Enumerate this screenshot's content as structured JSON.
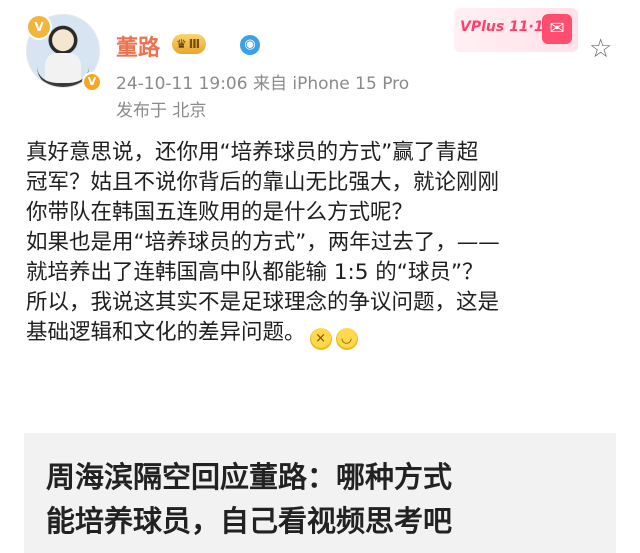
{
  "post": {
    "author": {
      "name": "董路",
      "level": "Ⅲ",
      "avatar_badge": "V",
      "verified_badge": "V"
    },
    "timestamp": "24-10-11 19:06",
    "source": "来自 iPhone 15 Pro",
    "location": "发布于 北京",
    "promo": {
      "label": "VPlus 11·11"
    },
    "body_lines": [
      "真好意思说，还你用“培养球员的方式”赢了青超",
      "冠军？姑且不说你背后的靠山无比强大，就论刚刚",
      "你带队在韩国五连败用的是什么方式呢？",
      "如果也是用“培养球员的方式”，两年过去了，——",
      "就培养出了连韩国高中队都能输 1:5 的“球员”？",
      "所以，我说这其实不是足球理念的争议问题，这是",
      "基础逻辑和文化的差异问题。"
    ],
    "emojis": [
      "fear-face-emoji",
      "laugh-tears-emoji"
    ]
  },
  "card": {
    "title_line1": "周海滨隔空回应董路：哪种方式",
    "title_line2": "能培养球员，自己看视频思考吧"
  },
  "colors": {
    "username": "#eb7350",
    "meta": "#8a8a8a",
    "card_bg": "#f2f2f2",
    "promo": "#ff3f6c"
  }
}
